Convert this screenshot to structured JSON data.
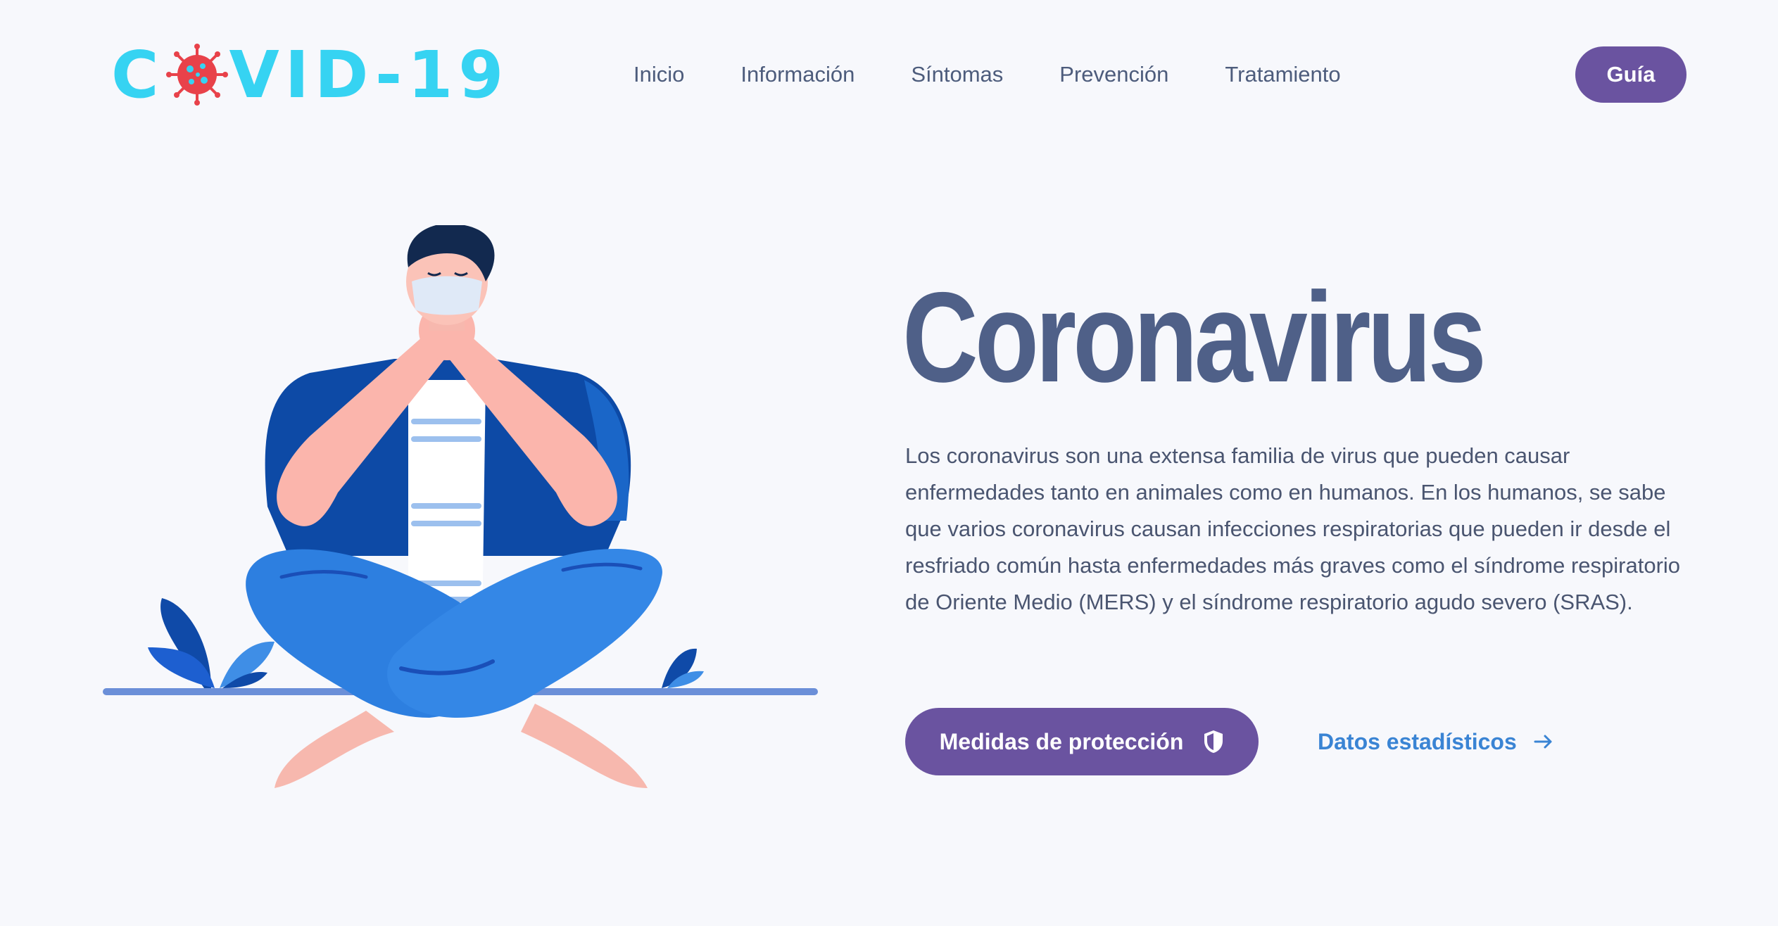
{
  "brand": {
    "logo_prefix": "C",
    "logo_suffix": "VID-19",
    "logo_color": "#36d3f2",
    "virus_color": "#e8424a"
  },
  "nav": {
    "items": [
      {
        "label": "Inicio"
      },
      {
        "label": "Información"
      },
      {
        "label": "Síntomas"
      },
      {
        "label": "Prevención"
      },
      {
        "label": "Tratamiento"
      }
    ],
    "cta_label": "Guía"
  },
  "hero": {
    "title": "Coronavirus",
    "description": "Los coronavirus son una extensa familia de virus que pueden causar enfermedades tanto en animales como en humanos. En los humanos, se sabe que varios coronavirus causan infecciones respiratorias que pueden ir desde el resfriado común hasta enfermedades más graves como el síndrome respiratorio de Oriente Medio (MERS) y el síndrome respiratorio agudo severo (SRAS).",
    "primary_button": {
      "label": "Medidas de protección",
      "icon": "shield-icon"
    },
    "secondary_link": {
      "label": "Datos estadísticos",
      "icon": "arrow-right-icon"
    }
  },
  "colors": {
    "background": "#f7f8fc",
    "accent_purple": "#6a53a0",
    "link_blue": "#3a84d4",
    "title": "#4f6088"
  },
  "illustration": {
    "icon": "person-coughing-with-mask-illustration"
  }
}
